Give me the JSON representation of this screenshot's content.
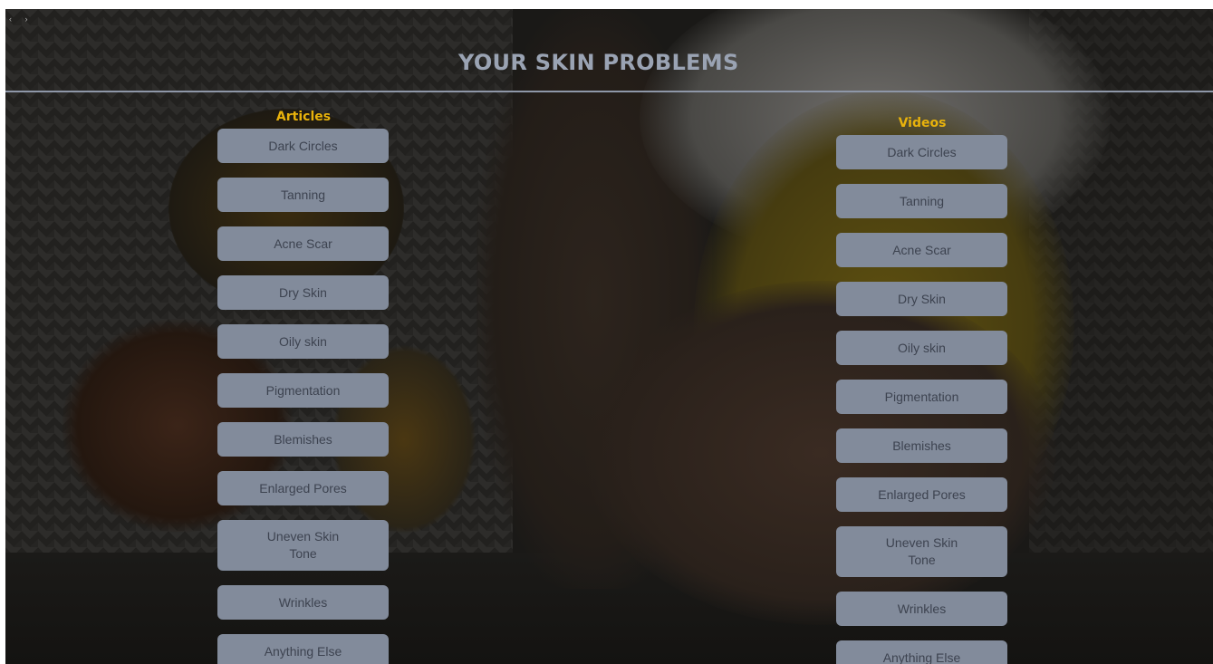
{
  "header": {
    "title": "YOUR SKIN PROBLEMS",
    "nav_dots": "‹ ›"
  },
  "articles": {
    "heading": "Articles",
    "items": [
      {
        "label": "Dark Circles"
      },
      {
        "label": "Tanning"
      },
      {
        "label": "Acne Scar"
      },
      {
        "label": "Dry Skin"
      },
      {
        "label": "Oily skin"
      },
      {
        "label": "Pigmentation"
      },
      {
        "label": "Blemishes"
      },
      {
        "label": "Enlarged Pores"
      },
      {
        "label": "Uneven Skin Tone"
      },
      {
        "label": "Wrinkles"
      },
      {
        "label": "Anything Else"
      }
    ]
  },
  "videos": {
    "heading": "Videos",
    "items": [
      {
        "label": "Dark Circles"
      },
      {
        "label": "Tanning"
      },
      {
        "label": "Acne Scar"
      },
      {
        "label": "Dry Skin"
      },
      {
        "label": "Oily skin"
      },
      {
        "label": "Pigmentation"
      },
      {
        "label": "Blemishes"
      },
      {
        "label": "Enlarged Pores"
      },
      {
        "label": "Uneven Skin Tone"
      },
      {
        "label": "Wrinkles"
      },
      {
        "label": "Anything Else"
      }
    ]
  },
  "colors": {
    "heading_accent": "#e8b20c",
    "title": "#9aa3b3",
    "button_bg": "#828b9b",
    "button_text": "#3d4350"
  }
}
